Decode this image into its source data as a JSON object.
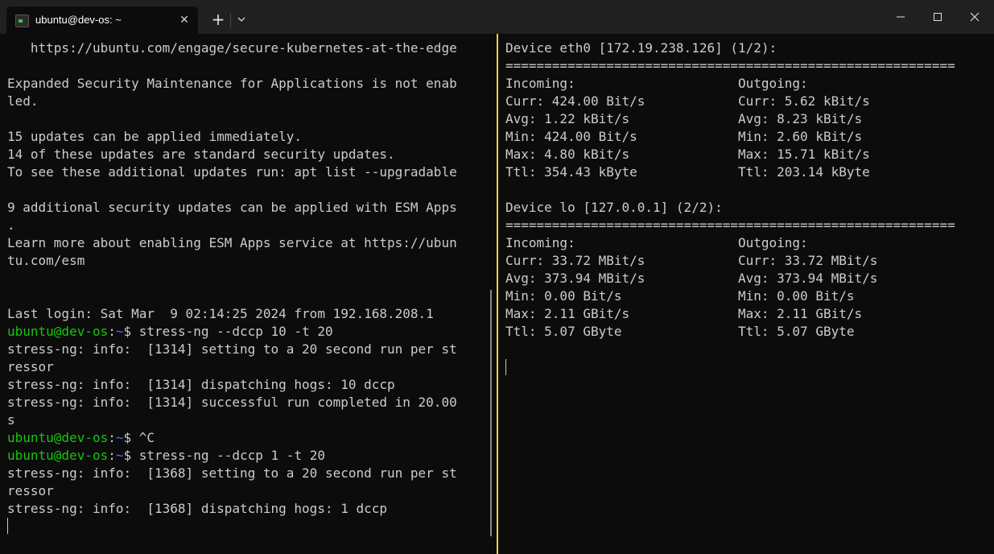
{
  "window": {
    "tab_title": "ubuntu@dev-os: ~",
    "tab_close": "✕",
    "new_tab": "+",
    "colors": {
      "prompt_host": "#16c60c",
      "prompt_path": "#3b78ff",
      "text": "#cccccc",
      "divider": "#f2cc4b"
    }
  },
  "left_pane": {
    "lines": [
      [
        {
          "t": "   https://ubuntu.com/engage/secure-kubernetes-at-the-edge"
        }
      ],
      [
        {
          "t": ""
        }
      ],
      [
        {
          "t": "Expanded Security Maintenance for Applications is not enab"
        }
      ],
      [
        {
          "t": "led."
        }
      ],
      [
        {
          "t": ""
        }
      ],
      [
        {
          "t": "15 updates can be applied immediately."
        }
      ],
      [
        {
          "t": "14 of these updates are standard security updates."
        }
      ],
      [
        {
          "t": "To see these additional updates run: apt list --upgradable"
        }
      ],
      [
        {
          "t": ""
        }
      ],
      [
        {
          "t": "9 additional security updates can be applied with ESM Apps"
        }
      ],
      [
        {
          "t": "."
        }
      ],
      [
        {
          "t": "Learn more about enabling ESM Apps service at https://ubun"
        }
      ],
      [
        {
          "t": "tu.com/esm"
        }
      ],
      [
        {
          "t": ""
        }
      ],
      [
        {
          "t": ""
        }
      ],
      [
        {
          "t": "Last login: Sat Mar  9 02:14:25 2024 from 192.168.208.1"
        }
      ],
      [
        {
          "t": "ubuntu@dev-os",
          "c": "host"
        },
        {
          "t": ":"
        },
        {
          "t": "~",
          "c": "path"
        },
        {
          "t": "$ stress-ng --dccp 10 -t 20"
        }
      ],
      [
        {
          "t": "stress-ng: info:  [1314] setting to a 20 second run per st"
        }
      ],
      [
        {
          "t": "ressor"
        }
      ],
      [
        {
          "t": "stress-ng: info:  [1314] dispatching hogs: 10 dccp"
        }
      ],
      [
        {
          "t": "stress-ng: info:  [1314] successful run completed in 20.00"
        }
      ],
      [
        {
          "t": "s"
        }
      ],
      [
        {
          "t": "ubuntu@dev-os",
          "c": "host"
        },
        {
          "t": ":"
        },
        {
          "t": "~",
          "c": "path"
        },
        {
          "t": "$ ^C"
        }
      ],
      [
        {
          "t": "ubuntu@dev-os",
          "c": "host"
        },
        {
          "t": ":"
        },
        {
          "t": "~",
          "c": "path"
        },
        {
          "t": "$ stress-ng --dccp 1 -t 20"
        }
      ],
      [
        {
          "t": "stress-ng: info:  [1368] setting to a 20 second run per st"
        }
      ],
      [
        {
          "t": "ressor"
        }
      ],
      [
        {
          "t": "stress-ng: info:  [1368] dispatching hogs: 1 dccp"
        }
      ]
    ]
  },
  "right_pane": {
    "lines": [
      [
        {
          "t": "Device eth0 [172.19.238.126] (1/2):"
        }
      ],
      [
        {
          "t": "=========================================================="
        }
      ],
      [
        {
          "t": "Incoming:                     Outgoing:"
        }
      ],
      [
        {
          "t": "Curr: 424.00 Bit/s            Curr: 5.62 kBit/s"
        }
      ],
      [
        {
          "t": "Avg: 1.22 kBit/s              Avg: 8.23 kBit/s"
        }
      ],
      [
        {
          "t": "Min: 424.00 Bit/s             Min: 2.60 kBit/s"
        }
      ],
      [
        {
          "t": "Max: 4.80 kBit/s              Max: 15.71 kBit/s"
        }
      ],
      [
        {
          "t": "Ttl: 354.43 kByte             Ttl: 203.14 kByte"
        }
      ],
      [
        {
          "t": ""
        }
      ],
      [
        {
          "t": "Device lo [127.0.0.1] (2/2):"
        }
      ],
      [
        {
          "t": "=========================================================="
        }
      ],
      [
        {
          "t": "Incoming:                     Outgoing:"
        }
      ],
      [
        {
          "t": "Curr: 33.72 MBit/s            Curr: 33.72 MBit/s"
        }
      ],
      [
        {
          "t": "Avg: 373.94 MBit/s            Avg: 373.94 MBit/s"
        }
      ],
      [
        {
          "t": "Min: 0.00 Bit/s               Min: 0.00 Bit/s"
        }
      ],
      [
        {
          "t": "Max: 2.11 GBit/s              Max: 2.11 GBit/s"
        }
      ],
      [
        {
          "t": "Ttl: 5.07 GByte               Ttl: 5.07 GByte"
        }
      ]
    ]
  }
}
